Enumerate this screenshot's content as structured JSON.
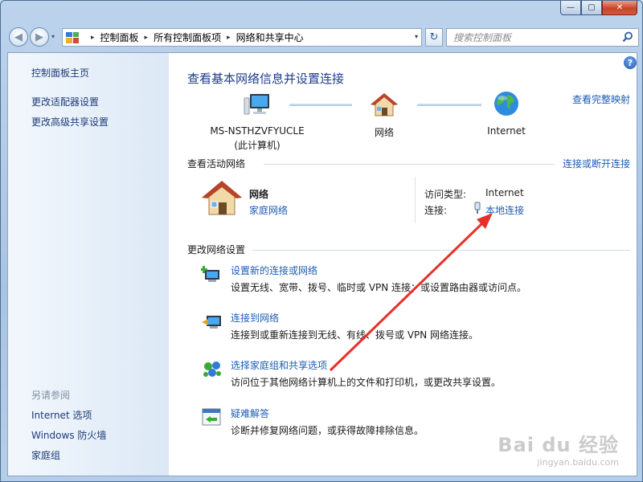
{
  "window": {
    "controls": {
      "minimize": "—",
      "maximize": "▢",
      "close": "✕"
    }
  },
  "nav": {
    "back_glyph": "◀",
    "forward_glyph": "▶",
    "dropdown_glyph": "▾",
    "breadcrumbs": [
      "控制面板",
      "所有控制面板项",
      "网络和共享中心"
    ],
    "breadcrumb_separator": "▸",
    "refresh_glyph": "↻",
    "search_placeholder": "搜索控制面板"
  },
  "sidebar": {
    "top_links": [
      "控制面板主页",
      "更改适配器设置",
      "更改高级共享设置"
    ],
    "see_also_heading": "另请参阅",
    "see_also_links": [
      "Internet 选项",
      "Windows 防火墙",
      "家庭组"
    ]
  },
  "main": {
    "help_glyph": "?",
    "title": "查看基本网络信息并设置连接",
    "full_map_link": "查看完整映射",
    "map": {
      "computer_name": "MS-NSTHZVFYUCLE",
      "computer_sub": "(此计算机)",
      "network_label": "网络",
      "internet_label": "Internet"
    },
    "active_networks": {
      "heading": "查看活动网络",
      "connect_link": "连接或断开连接",
      "network_name": "网络",
      "network_type_link": "家庭网络",
      "access_type_label": "访问类型:",
      "access_type_value": "Internet",
      "connections_label": "连接:",
      "connection_link": "本地连接"
    },
    "change_settings": {
      "heading": "更改网络设置",
      "tasks": [
        {
          "icon": "new-connection-icon",
          "link": "设置新的连接或网络",
          "desc": "设置无线、宽带、拨号、临时或 VPN 连接；或设置路由器或访问点。"
        },
        {
          "icon": "connect-network-icon",
          "link": "连接到网络",
          "desc": "连接到或重新连接到无线、有线、拨号或 VPN 网络连接。"
        },
        {
          "icon": "homegroup-icon",
          "link": "选择家庭组和共享选项",
          "desc": "访问位于其他网络计算机上的文件和打印机，或更改共享设置。"
        },
        {
          "icon": "troubleshoot-icon",
          "link": "疑难解答",
          "desc": "诊断并修复网络问题，或获得故障排除信息。"
        }
      ]
    }
  },
  "watermark": {
    "main": "Bai du 经验",
    "sub": "jingyan.baidu.com"
  },
  "colors": {
    "link": "#1e5cb4",
    "title": "#1e3c8c",
    "annotation_arrow": "#e8302a"
  }
}
